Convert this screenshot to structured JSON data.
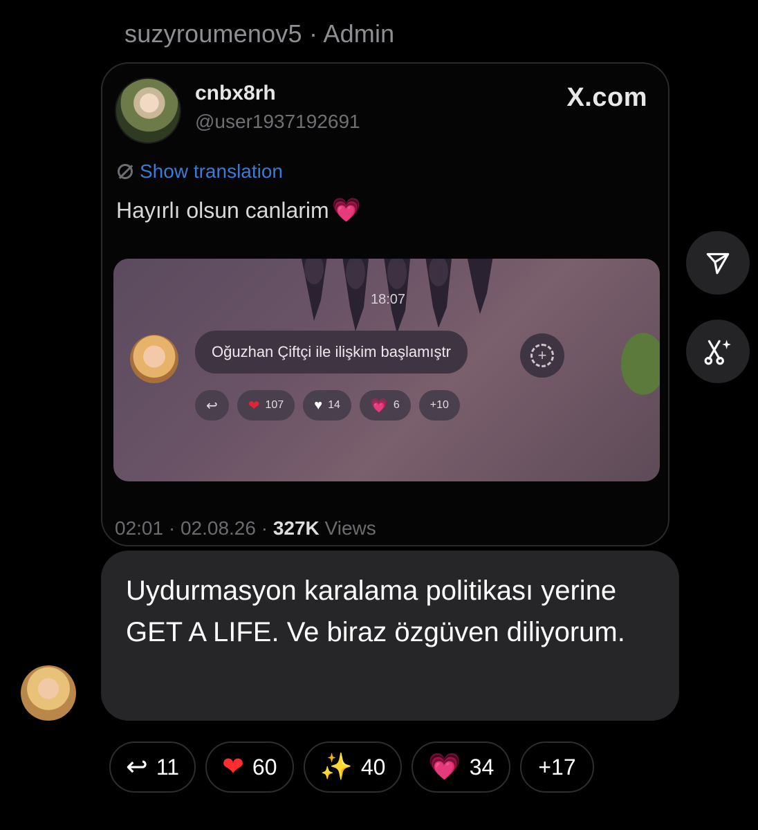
{
  "message": {
    "sender_name": "suzyroumenov5",
    "sender_separator": "·",
    "sender_role": "Admin",
    "text": "Uydurmasyon karalama politikası yerine GET A LIFE. Ve biraz özgüven diliyorum."
  },
  "shared_post": {
    "display_name": "cnbx8rh",
    "handle": "@user1937192691",
    "source": "X.com",
    "translation_label": "Show translation",
    "text": "Hayırlı olsun canlarim",
    "text_emoji": "💗",
    "meta_time": "02:01 · 02.08.26 ·",
    "views_count": "327K",
    "views_label": "Views",
    "media": {
      "time": "18:07",
      "bubble_text": "Oğuzhan Çiftçi ile ilişkim başlamıştr",
      "reactions": [
        {
          "icon": "reply-icon",
          "symbol": "↩",
          "count": ""
        },
        {
          "icon": "red-heart-icon",
          "symbol": "❤",
          "count": "107"
        },
        {
          "icon": "white-heart-icon",
          "symbol": "♥",
          "count": "14"
        },
        {
          "icon": "pink-heart-icon",
          "symbol": "💗",
          "count": "6"
        },
        {
          "icon": "more-icon",
          "symbol": "",
          "count": "+10"
        }
      ]
    }
  },
  "side_actions": {
    "share": "share-icon",
    "ai_edit": "ai-sparkle-icon"
  },
  "reactions": {
    "reply": {
      "symbol": "↩",
      "count": "11"
    },
    "heart": {
      "symbol": "❤",
      "count": "60"
    },
    "sparkles": {
      "symbol": "✨",
      "count": "40"
    },
    "pink_heart": {
      "symbol": "💗",
      "count": "34"
    },
    "more": "+17"
  },
  "colors": {
    "background": "#000000",
    "bubble": "#262628",
    "link_blue": "#3a7bd5",
    "muted_text": "#8e8e93"
  }
}
